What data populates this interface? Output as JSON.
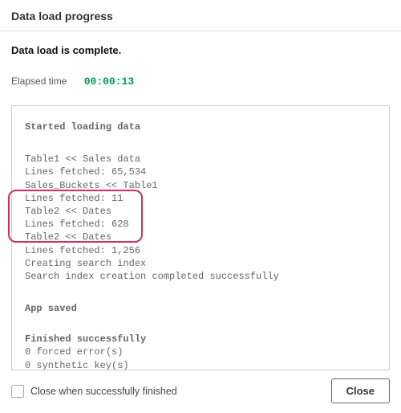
{
  "header": {
    "title": "Data load progress"
  },
  "status": {
    "complete_msg": "Data load is complete.",
    "elapsed_label": "Elapsed time",
    "elapsed_time": "00:00:13"
  },
  "log": {
    "start_heading": "Started loading data",
    "lines": [
      "Table1 << Sales data",
      "Lines fetched: 65,534",
      "Sales_Buckets << Table1",
      "Lines fetched: 11",
      "Table2 << Dates",
      "Lines fetched: 628",
      "Table2 << Dates",
      "Lines fetched: 1,256",
      "Creating search index",
      "Search index creation completed successfully"
    ],
    "saved_heading": "App saved",
    "finished_heading": "Finished successfully",
    "forced_errors": "0 forced error(s)",
    "synthetic_keys": "0 synthetic key(s)"
  },
  "footer": {
    "checkbox_label": "Close when successfully finished",
    "close_button": "Close"
  }
}
